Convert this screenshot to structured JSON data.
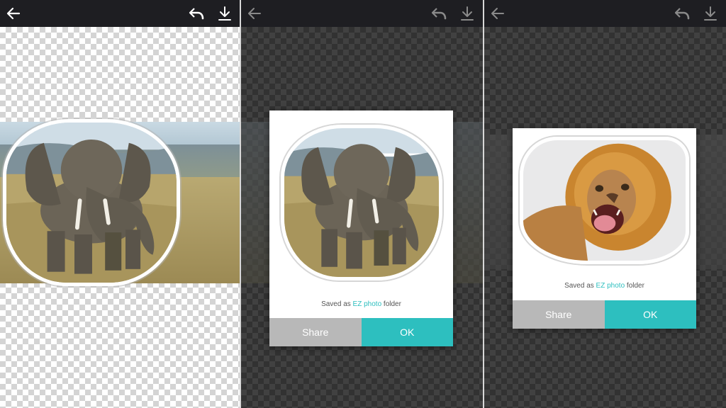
{
  "toolbar": {
    "back_icon": "arrow-left-icon",
    "undo_icon": "undo-icon",
    "download_icon": "download-icon",
    "icon_color_active": "#ffffff",
    "icon_color_dimmed": "#8a8a8a"
  },
  "dialog": {
    "message_prefix": "Saved as ",
    "message_accent": "EZ photo",
    "message_suffix": " folder",
    "share_label": "Share",
    "ok_label": "OK"
  },
  "colors": {
    "accent": "#2dbfbf",
    "share_button": "#b8b8b8",
    "topbar": "#1e1e22"
  }
}
